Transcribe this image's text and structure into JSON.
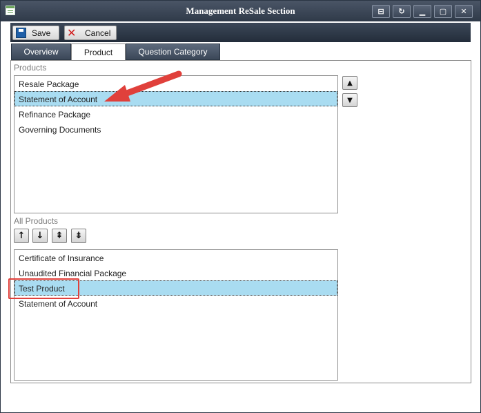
{
  "window": {
    "title": "Management ReSale Section",
    "title_buttons": [
      "restore-glyph",
      "refresh-glyph",
      "minimize-glyph",
      "maximize-glyph",
      "close-glyph"
    ]
  },
  "toolbar": {
    "save_label": "Save",
    "cancel_label": "Cancel"
  },
  "tabs": [
    {
      "label": "Overview",
      "active": false
    },
    {
      "label": "Product",
      "active": true
    },
    {
      "label": "Question Category",
      "active": false
    }
  ],
  "products": {
    "label": "Products",
    "items": [
      {
        "label": "Resale Package",
        "selected": false
      },
      {
        "label": "Statement of Account",
        "selected": true
      },
      {
        "label": "Refinance Package",
        "selected": false
      },
      {
        "label": "Governing Documents",
        "selected": false
      }
    ]
  },
  "all_products": {
    "label": "All Products",
    "items": [
      {
        "label": "Certificate of Insurance",
        "selected": false
      },
      {
        "label": "Unaudited Financial Package",
        "selected": false
      },
      {
        "label": "Test Product",
        "selected": true
      },
      {
        "label": "Statement of Account",
        "selected": false
      }
    ]
  },
  "colors": {
    "selection": "#a9dcf1",
    "annotation_red": "#e0403b",
    "titlebar_dark": "#2f3a49"
  },
  "icons": {
    "move_up": "arrow-up-icon",
    "move_down": "arrow-down-icon",
    "move_top": "double-arrow-up-icon",
    "move_bottom": "double-arrow-down-icon"
  }
}
